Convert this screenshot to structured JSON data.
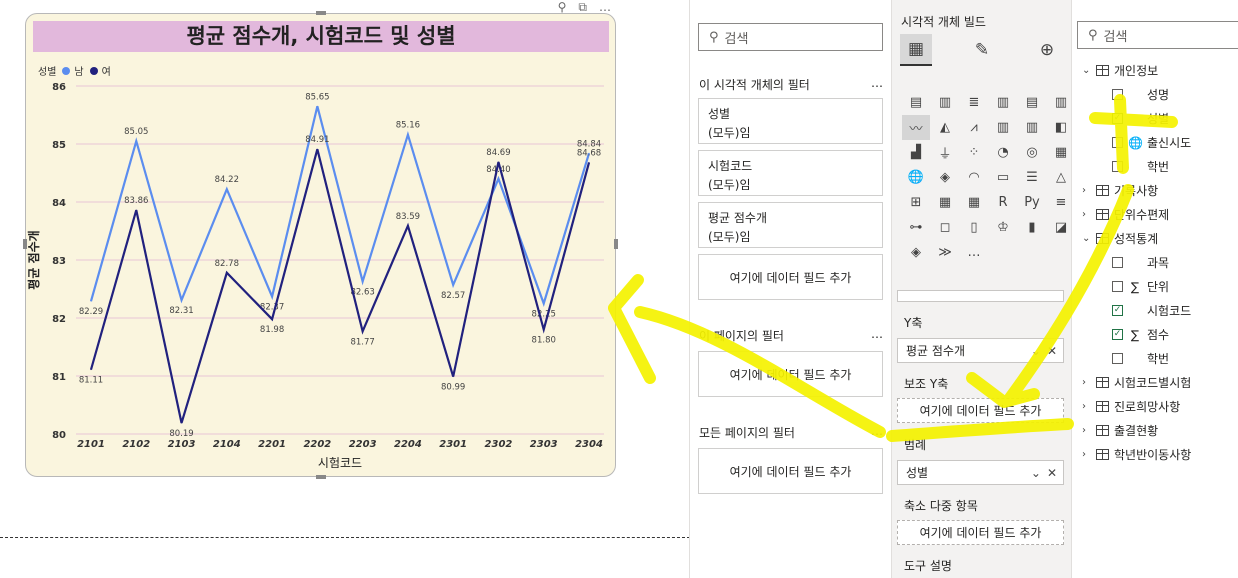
{
  "visual": {
    "title": "평균 점수개, 시험코드 및 성별",
    "legend_title": "성별",
    "toolbar": [
      "⚲",
      "⧉",
      "…"
    ]
  },
  "chart_data": {
    "type": "line",
    "title": "평균 점수개, 시험코드 및 성별",
    "xlabel": "시험코드",
    "ylabel": "평균 점수개",
    "categories": [
      "2101",
      "2102",
      "2103",
      "2104",
      "2201",
      "2202",
      "2203",
      "2204",
      "2301",
      "2302",
      "2303",
      "2304"
    ],
    "ylim": [
      80,
      86
    ],
    "yticks": [
      80,
      81,
      82,
      83,
      84,
      85,
      86
    ],
    "series": [
      {
        "name": "남",
        "color": "#5b8def",
        "values": [
          82.29,
          85.05,
          82.31,
          84.22,
          82.37,
          85.65,
          82.63,
          85.16,
          82.57,
          84.4,
          82.25,
          84.84
        ]
      },
      {
        "name": "여",
        "color": "#21217e",
        "values": [
          81.11,
          83.86,
          80.19,
          82.78,
          81.98,
          84.91,
          81.77,
          83.59,
          80.99,
          84.69,
          81.8,
          84.68
        ]
      }
    ],
    "legend_position": "top-left",
    "grid": true
  },
  "filters_pane": {
    "search_placeholder": "검색",
    "visual_filters_title": "이 시각적 개체의 필터",
    "visual_filters": [
      {
        "field": "성별",
        "state": "(모두)임"
      },
      {
        "field": "시험코드",
        "state": "(모두)임"
      },
      {
        "field": "평균 점수개",
        "state": "(모두)임"
      }
    ],
    "add_field": "여기에 데이터 필드 추가",
    "page_filters_title": "이 페이지의 필터",
    "all_pages_title": "모든 페이지의 필터",
    "more": "…"
  },
  "viz_pane": {
    "header": "시각적 개체 빌드",
    "more_visuals": "…",
    "y_axis_label": "Y축",
    "y_axis_field": "평균 점수개",
    "secondary_y_label": "보조 Y축",
    "secondary_y_placeholder": "여기에 데이터 필드 추가",
    "legend_label": "범례",
    "legend_field": "성별",
    "small_multiples_label": "축소 다중 항목",
    "small_multiples_placeholder": "여기에 데이터 필드 추가",
    "tooltip_label": "도구 설명"
  },
  "fields_pane": {
    "search_placeholder": "검색",
    "tables": [
      {
        "name": "개인정보",
        "expanded": true,
        "fields": [
          {
            "name": "성명",
            "checked": false,
            "type": "text"
          },
          {
            "name": "성별",
            "checked": true,
            "type": "text"
          },
          {
            "name": "출신시도",
            "checked": false,
            "type": "geo"
          },
          {
            "name": "학번",
            "checked": false,
            "type": "text"
          }
        ]
      },
      {
        "name": "기록사항",
        "expanded": false
      },
      {
        "name": "단위수편제",
        "expanded": false
      },
      {
        "name": "성적통계",
        "expanded": true,
        "fields": [
          {
            "name": "과목",
            "checked": false,
            "type": "text"
          },
          {
            "name": "단위",
            "checked": false,
            "type": "sum"
          },
          {
            "name": "시험코드",
            "checked": true,
            "type": "text"
          },
          {
            "name": "점수",
            "checked": true,
            "type": "sum"
          },
          {
            "name": "학번",
            "checked": false,
            "type": "text"
          }
        ]
      },
      {
        "name": "시험코드별시험",
        "expanded": false
      },
      {
        "name": "진로희망사항",
        "expanded": false
      },
      {
        "name": "출결현황",
        "expanded": false
      },
      {
        "name": "학년반이동사항",
        "expanded": false
      }
    ]
  },
  "colors": {
    "highlight": "#f5f200",
    "check": "#217346",
    "title_bg": "#e2b8dc",
    "plot_bg": "#faf5de"
  }
}
